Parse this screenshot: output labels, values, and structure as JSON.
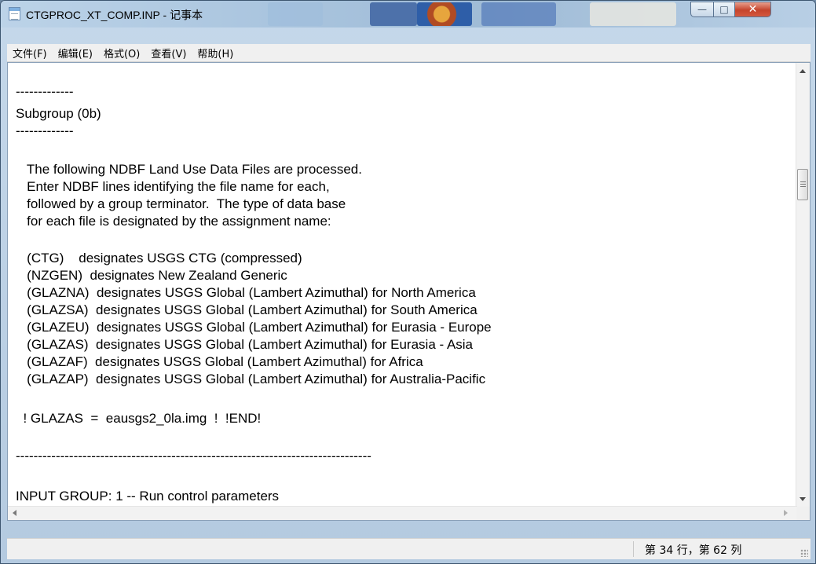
{
  "window": {
    "title": "CTGPROC_XT_COMP.INP - 记事本",
    "buttons": {
      "minimize": "—",
      "maximize": "□",
      "close": "✕"
    }
  },
  "menu": [
    "文件(F)",
    "编辑(E)",
    "格式(O)",
    "查看(V)",
    "帮助(H)"
  ],
  "editor": {
    "lines": [
      "-------------",
      "Subgroup (0b)",
      "-------------",
      "   The following NDBF Land Use Data Files are processed.",
      "   Enter NDBF lines identifying the file name for each,",
      "   followed by a group terminator.  The type of data base",
      "   for each file is designated by the assignment name:",
      "   (CTG)    designates USGS CTG (compressed)",
      "   (NZGEN)  designates New Zealand Generic",
      "   (GLAZNA)  designates USGS Global (Lambert Azimuthal) for North America",
      "   (GLAZSA)  designates USGS Global (Lambert Azimuthal) for South America",
      "   (GLAZEU)  designates USGS Global (Lambert Azimuthal) for Eurasia - Europe",
      "   (GLAZAS)  designates USGS Global (Lambert Azimuthal) for Eurasia - Asia",
      "   (GLAZAF)  designates USGS Global (Lambert Azimuthal) for Africa",
      "   (GLAZAP)  designates USGS Global (Lambert Azimuthal) for Australia-Pacific",
      "  ! GLAZAS  =  eausgs2_0la.img  !  !END!",
      "--------------------------------------------------------------------------------",
      "INPUT GROUP: 1 -- Run control parameters"
    ]
  },
  "status": {
    "position": "第 34 行，第 62 列"
  }
}
